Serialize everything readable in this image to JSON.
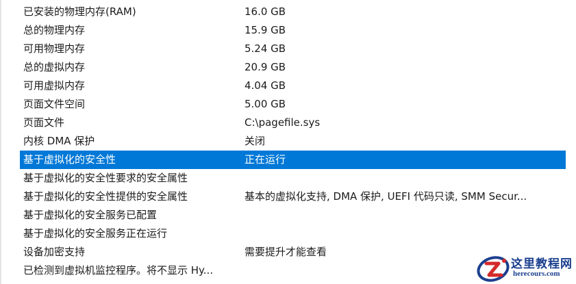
{
  "rows": [
    {
      "item": "已安装的物理内存(RAM)",
      "value": "16.0 GB"
    },
    {
      "item": "总的物理内存",
      "value": "15.9 GB"
    },
    {
      "item": "可用物理内存",
      "value": "5.24 GB"
    },
    {
      "item": "总的虚拟内存",
      "value": "20.9 GB"
    },
    {
      "item": "可用虚拟内存",
      "value": "4.04 GB"
    },
    {
      "item": "页面文件空间",
      "value": "5.00 GB"
    },
    {
      "item": "页面文件",
      "value": "C:\\pagefile.sys"
    },
    {
      "item": "内核 DMA 保护",
      "value": "关闭"
    },
    {
      "item": "基于虚拟化的安全性",
      "value": "正在运行"
    },
    {
      "item": "基于虚拟化的安全性要求的安全属性",
      "value": ""
    },
    {
      "item": "基于虚拟化的安全性提供的安全属性",
      "value": "基本的虚拟化支持, DMA 保护, UEFI 代码只读, SMM Secur..."
    },
    {
      "item": "基于虚拟化的安全服务已配置",
      "value": ""
    },
    {
      "item": "基于虚拟化的安全服务正在运行",
      "value": ""
    },
    {
      "item": "设备加密支持",
      "value": "需要提升才能查看"
    },
    {
      "item": "已检测到虚拟机监控程序。将不显示 Hy...",
      "value": ""
    }
  ],
  "selected_row_index": 8,
  "watermark": {
    "title": "这里教程网",
    "url": "herecours.com"
  },
  "colors": {
    "selection": "#0078d7",
    "selection_text": "#ffffff",
    "text": "#1b1b1b",
    "watermark": "#1b3f8f",
    "watermark_accent": "#d42a2a"
  }
}
